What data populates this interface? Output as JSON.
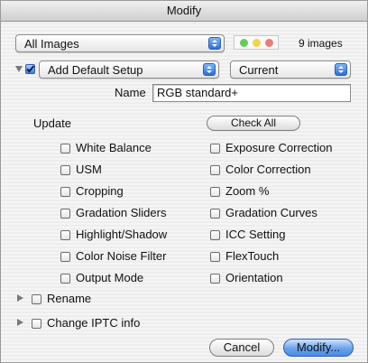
{
  "window": {
    "title": "Modify"
  },
  "source": {
    "selected": "All Images",
    "count": "9 images"
  },
  "setup": {
    "checked": true,
    "action": "Add Default Setup",
    "mode": "Current",
    "name_label": "Name",
    "name_value": "RGB standard+"
  },
  "update": {
    "label": "Update",
    "check_all_label": "Check All",
    "left": [
      {
        "label": "White Balance",
        "checked": false
      },
      {
        "label": "USM",
        "checked": false
      },
      {
        "label": "Cropping",
        "checked": false
      },
      {
        "label": "Gradation Sliders",
        "checked": false
      },
      {
        "label": "Highlight/Shadow",
        "checked": false
      },
      {
        "label": "Color Noise Filter",
        "checked": false
      },
      {
        "label": "Output Mode",
        "checked": false
      }
    ],
    "right": [
      {
        "label": "Exposure Correction",
        "checked": false
      },
      {
        "label": "Color Correction",
        "checked": false
      },
      {
        "label": "Zoom %",
        "checked": false
      },
      {
        "label": "Gradation Curves",
        "checked": false
      },
      {
        "label": "ICC Setting",
        "checked": false
      },
      {
        "label": "FlexTouch",
        "checked": false
      },
      {
        "label": "Orientation",
        "checked": false
      }
    ]
  },
  "sections": {
    "rename": {
      "label": "Rename",
      "checked": false
    },
    "iptc": {
      "label": "Change IPTC info",
      "checked": false
    }
  },
  "footer": {
    "cancel_label": "Cancel",
    "modify_label": "Modify..."
  },
  "colors": {
    "green": "#5fcf5a",
    "yellow": "#f2d54a",
    "red": "#f07a7a",
    "accent": "#3d7fdc"
  }
}
